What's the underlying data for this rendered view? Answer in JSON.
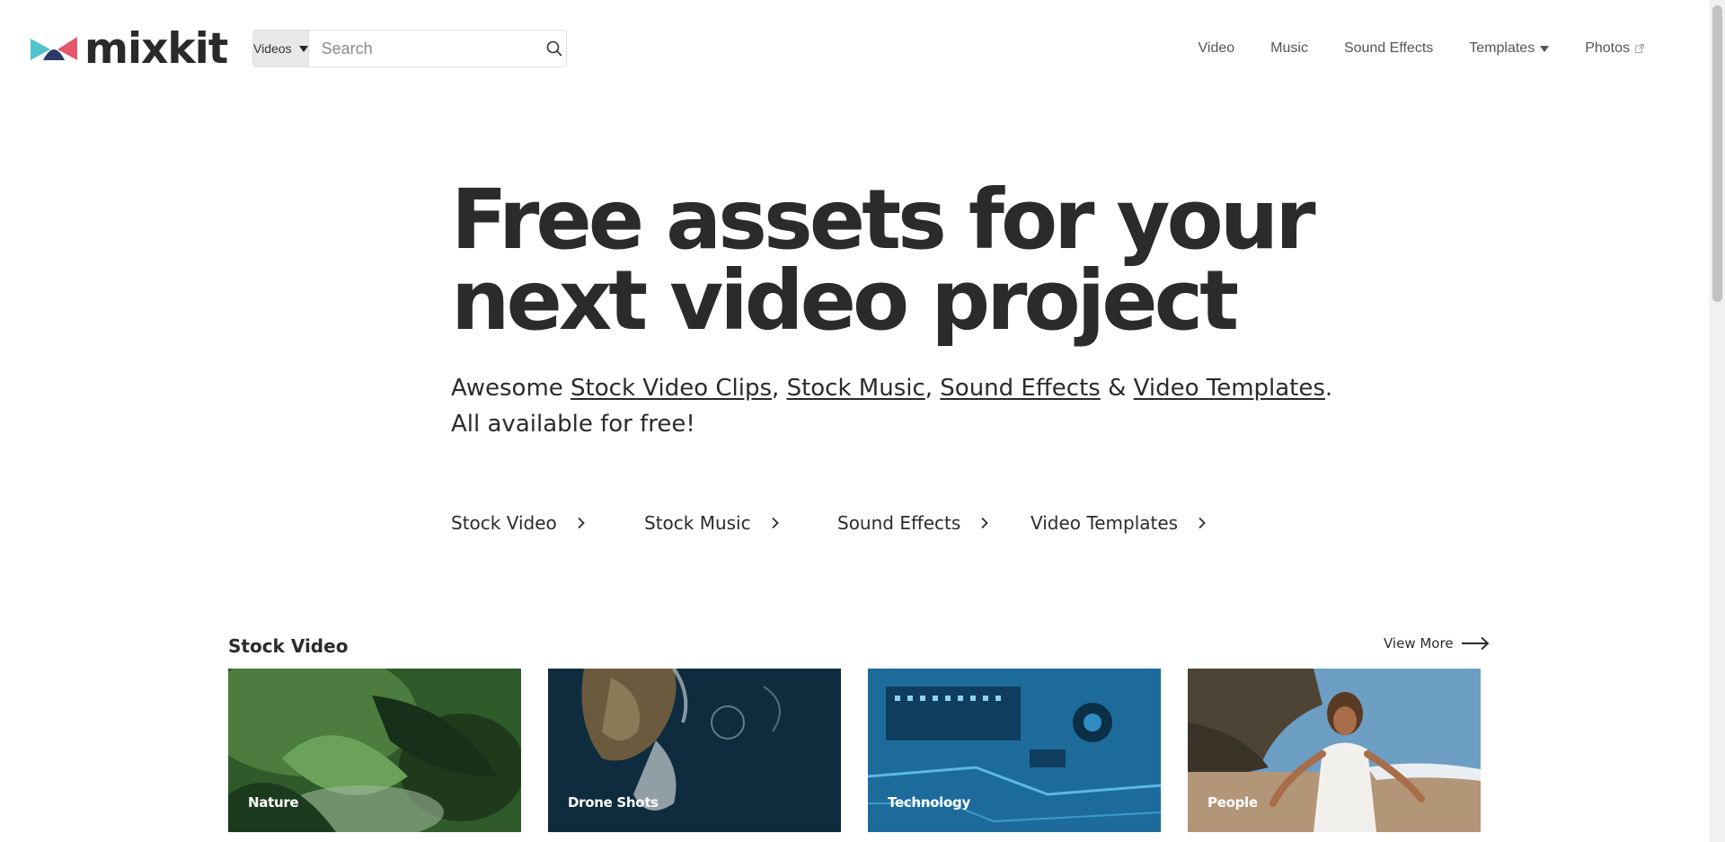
{
  "brand": {
    "name": "mixkit"
  },
  "search": {
    "type_label": "Videos",
    "placeholder": "Search"
  },
  "nav": {
    "video": "Video",
    "music": "Music",
    "sound_effects": "Sound Effects",
    "templates": "Templates",
    "photos": "Photos"
  },
  "hero": {
    "title_line1": "Free assets for your",
    "title_line2": "next video project",
    "sub_prefix": "Awesome ",
    "link_clips": "Stock Video Clips",
    "link_music": "Stock Music",
    "link_sfx": "Sound Effects",
    "amp": " & ",
    "link_templates": "Video Templates",
    "sub_line2": "All available for free!"
  },
  "quick_links": [
    "Stock Video",
    "Stock Music",
    "Sound Effects",
    "Video Templates"
  ],
  "stock_video": {
    "title": "Stock Video",
    "view_more": "View More",
    "cards": [
      "Nature",
      "Drone Shots",
      "Technology",
      "People"
    ]
  },
  "colors": {
    "text": "#2b2b2b",
    "nav": "#555555",
    "logo_teal": "#4fc3c7",
    "logo_pink": "#e4576a",
    "logo_navy": "#2b3a6b"
  }
}
